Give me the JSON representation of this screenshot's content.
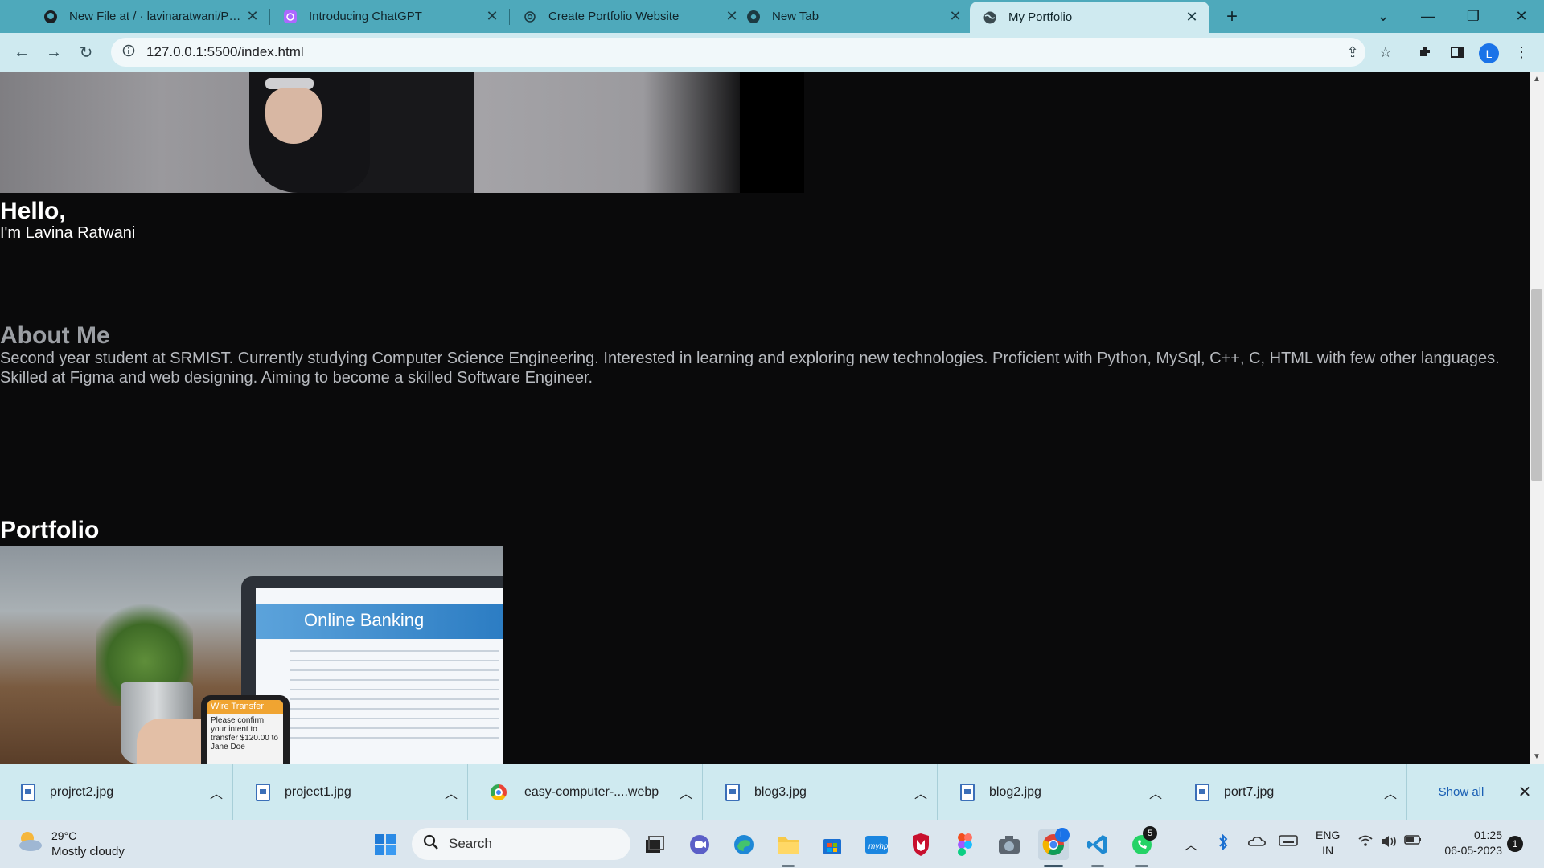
{
  "browser": {
    "tabs": [
      {
        "title": "New File at / · lavinaratwani/Portf",
        "icon": "github-icon"
      },
      {
        "title": "Introducing ChatGPT",
        "icon": "openai-icon"
      },
      {
        "title": "Create Portfolio Website",
        "icon": "openai-icon"
      },
      {
        "title": "New Tab",
        "icon": "chrome-icon"
      },
      {
        "title": "My Portfolio",
        "icon": "globe-icon",
        "active": true
      }
    ],
    "new_tab_label": "+",
    "url": "127.0.0.1:5500/index.html",
    "profile_initial": "L",
    "accent": "#4ea9bb"
  },
  "page": {
    "hello": "Hello,",
    "name_line": "I'm Lavina Ratwani",
    "about_heading": "About Me",
    "about_text": "Second year student at SRMIST. Currently studying Computer Science Engineering. Interested in learning and exploring new technologies. Proficient with Python, MySql, C++, C, HTML with few other languages. Skilled at Figma and web designing. Aiming to become a skilled Software Engineer.",
    "portfolio_heading": "Portfolio",
    "project_image_text": {
      "banner": "Online Banking",
      "phone_title": "Wire Transfer",
      "phone_body": "Please confirm your intent to transfer $120.00 to Jane Doe"
    }
  },
  "downloads": {
    "items": [
      {
        "name": "projrct2.jpg",
        "type": "image"
      },
      {
        "name": "project1.jpg",
        "type": "image"
      },
      {
        "name": "easy-computer-....webp",
        "type": "chrome"
      },
      {
        "name": "blog3.jpg",
        "type": "image"
      },
      {
        "name": "blog2.jpg",
        "type": "image"
      },
      {
        "name": "port7.jpg",
        "type": "image"
      }
    ],
    "show_all": "Show all"
  },
  "taskbar": {
    "weather_temp": "29°C",
    "weather_desc": "Mostly cloudy",
    "search_label": "Search",
    "whatsapp_badge": "5",
    "chrome_badge": "L",
    "lang_top": "ENG",
    "lang_bottom": "IN",
    "time": "01:25",
    "date": "06-05-2023",
    "notifications": "1"
  }
}
